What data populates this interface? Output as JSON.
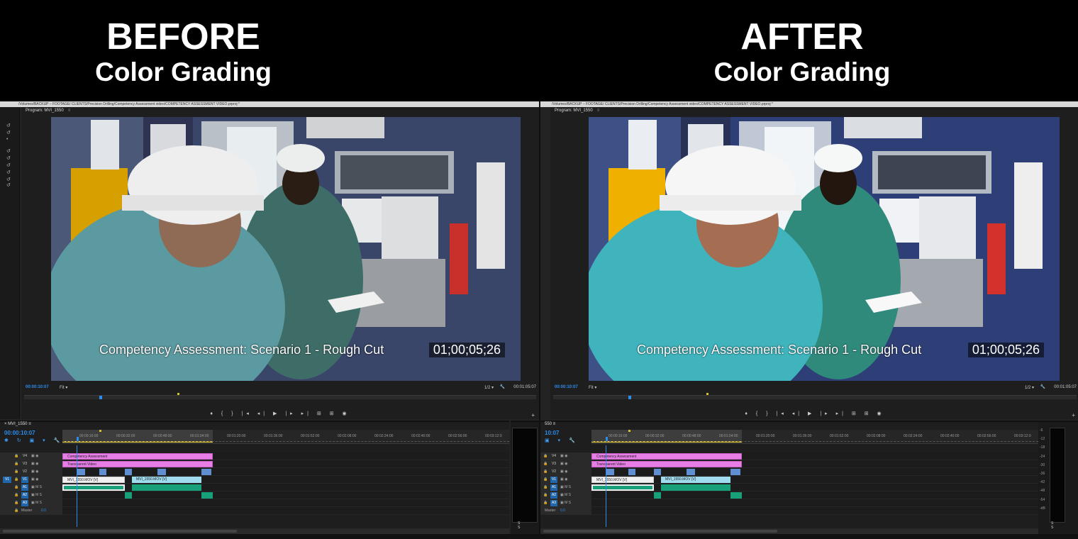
{
  "headline": {
    "before_big": "BEFORE",
    "before_small": "Color Grading",
    "after_big": "AFTER",
    "after_small": "Color Grading"
  },
  "before": {
    "path": "/Volumes/BACKUP – FOOTAGE/ CLIENTS/Precision Drilling/Competency Assessment video/COMPETENCY ASSESSMENT VIDEO.prproj *",
    "program_tab": "Program: MVI_1550",
    "overlay_title": "Competency Assessment: Scenario 1 - Rough Cut",
    "overlay_timecode": "01;00;05;26",
    "current_tc": "00:00:10:07",
    "fit": "Fit",
    "resolution": "1/2",
    "duration_tc": "00:01:05:07",
    "seq_tab": "MVI_1550",
    "seq_tc": "00:00:10:07"
  },
  "after": {
    "path": "/Volumes/BACKUP – FOOTAGE/ CLIENTS/Precision Drilling/Competency Assessment video/COMPETENCY ASSESSMENT VIDEO.prproj *",
    "program_tab": "Program: MVI_1550",
    "overlay_title": "Competency Assessment: Scenario 1 - Rough Cut",
    "overlay_timecode": "01;00;05;26",
    "current_tc": "00:00:10:07",
    "fit": "Fit",
    "resolution": "1/2",
    "duration_tc": "00:01:05:07",
    "seq_tab": "550",
    "seq_tc": "10:07"
  },
  "ruler_ticks": [
    "00:00:16:00",
    "00:00:32:00",
    "00:00:48:00",
    "00:01:04:00",
    "00:01:20:00",
    "00:01:36:00",
    "00:01:52:00",
    "00:02:08:00",
    "00:02:24:00",
    "00:02:40:00",
    "00:02:56:00",
    "00:03:12:0"
  ],
  "tracks": {
    "v4": "V4",
    "v3": "V3",
    "v2": "V2",
    "v1": "V1",
    "a1": "A1",
    "a2": "A2",
    "a3": "A3",
    "master": "Master",
    "master_val": "0.0"
  },
  "clips": {
    "competency": "Competency Assessment",
    "transparent": "Transparent Video",
    "mvi_a": "MVI_1550.MOV [V]",
    "mvi_b": "MVI_1550.MOV [V]"
  },
  "meter": {
    "scale": [
      "-6",
      "-12",
      "-18",
      "-24",
      "-30",
      "-36",
      "-42",
      "-48",
      "-54",
      "-dB"
    ],
    "solo": "S S"
  },
  "transport_icons": "♦ { } |◂ ◂| ▶ |▸ ▸| ⊞ ⊞ ◉",
  "colors": {
    "accent_blue": "#2d8ceb",
    "clip_pink": "#e77ee6",
    "clip_cyan": "#9fdcf0",
    "clip_green": "#17a07a",
    "work_area_yellow": "#e0c93a"
  }
}
